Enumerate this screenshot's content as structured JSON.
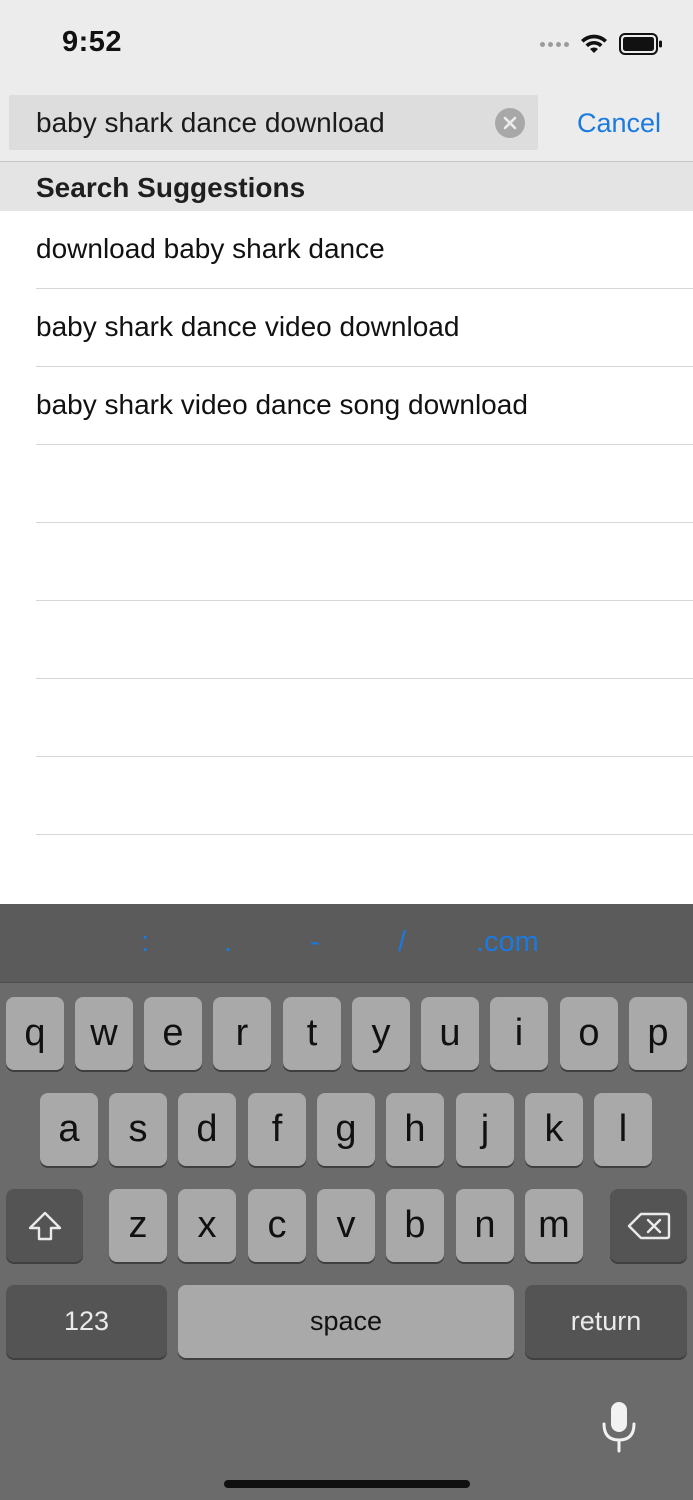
{
  "status_bar": {
    "time": "9:52"
  },
  "search": {
    "query": "baby shark dance download",
    "cancel_label": "Cancel"
  },
  "suggestions": {
    "header": "Search Suggestions",
    "items": [
      "download baby shark dance",
      "baby shark dance video download",
      "baby shark video dance song download"
    ]
  },
  "keyboard": {
    "shortcuts": [
      ":",
      ".",
      "-",
      "/",
      ".com"
    ],
    "row1": [
      "q",
      "w",
      "e",
      "r",
      "t",
      "y",
      "u",
      "i",
      "o",
      "p"
    ],
    "row2": [
      "a",
      "s",
      "d",
      "f",
      "g",
      "h",
      "j",
      "k",
      "l"
    ],
    "row3": [
      "z",
      "x",
      "c",
      "v",
      "b",
      "n",
      "m"
    ],
    "numbers_label": "123",
    "space_label": "space",
    "return_label": "return"
  },
  "colors": {
    "accent": "#1a7ae0",
    "header_bg": "#e4e4e4",
    "keyboard_bg": "#6b6b6b"
  }
}
